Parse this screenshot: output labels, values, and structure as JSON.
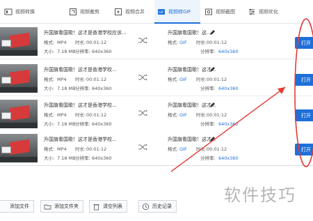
{
  "tabs": [
    {
      "id": "video-recording",
      "label": "视频转换",
      "icon": "film-icon"
    },
    {
      "id": "video-crop",
      "label": "视频裁剪",
      "icon": "crop-icon"
    },
    {
      "id": "video-merge",
      "label": "视频合并",
      "icon": "merge-icon"
    },
    {
      "id": "video-to-gif",
      "label": "视频转GIF",
      "icon": "gif-icon",
      "active": true
    },
    {
      "id": "video-screenshot",
      "label": "视频截图",
      "icon": "screenshot-icon"
    },
    {
      "id": "video-optimize",
      "label": "视频优化",
      "icon": "optimize-icon"
    }
  ],
  "rows": [
    {
      "name": "升国旗看国歌！这才是香港学校应该...",
      "src_format_label": "格式:",
      "src_format": "MP4",
      "src_duration_label": "时长:",
      "src_duration": "00:01:12",
      "src_size_label": "大小:",
      "src_size": "7.18 MB",
      "src_res_label": "分辨率:",
      "src_res": "640x360",
      "out_name": "升国旗看国歌！这...",
      "out_format_label": "格式:",
      "out_format": "GIF",
      "out_duration_label": "时长:",
      "out_duration": "00:01:12",
      "out_res_label": "分辨率:",
      "out_res": "640x360",
      "convert_label": "打开"
    },
    {
      "name": "升国旗看国歌！这才是香港学校...",
      "src_format_label": "格式:",
      "src_format": "MP4",
      "src_duration_label": "时长:",
      "src_duration": "00:01:12",
      "src_size_label": "大小:",
      "src_size": "7.18 MB",
      "src_res_label": "分辨率:",
      "src_res": "640x360",
      "out_name": "升国旗看国歌！这才...",
      "out_format_label": "格式:",
      "out_format": "GIF",
      "out_duration_label": "时长:",
      "out_duration": "00:01:12",
      "out_res_label": "分辨率:",
      "out_res": "640x360",
      "convert_label": "打开"
    },
    {
      "name": "升国旗看国歌！这才是香港学校...",
      "src_format_label": "格式:",
      "src_format": "MP4",
      "src_duration_label": "时长:",
      "src_duration": "00:01:12",
      "src_size_label": "大小:",
      "src_size": "7.18 MB",
      "src_res_label": "分辨率:",
      "src_res": "640x360",
      "out_name": "升国旗看国歌！这才...",
      "out_format_label": "格式:",
      "out_format": "GIF",
      "out_duration_label": "时长:",
      "out_duration": "00:01:12",
      "out_res_label": "分辨率:",
      "out_res": "640x360",
      "convert_label": "打开"
    },
    {
      "name": "升国旗看国歌！这才是香港学校...",
      "src_format_label": "格式:",
      "src_format": "MP4",
      "src_duration_label": "时长:",
      "src_duration": "00:01:12",
      "src_size_label": "大小:",
      "src_size": "7.18 MB",
      "src_res_label": "分辨率:",
      "src_res": "640x360",
      "out_name": "升国旗看国歌！这才...",
      "out_format_label": "格式:",
      "out_format": "GIF",
      "out_duration_label": "时长:",
      "out_duration": "00:01:12",
      "out_res_label": "分辨率:",
      "out_res": "640x360",
      "convert_label": "打开"
    }
  ],
  "bottom": {
    "add_file": "添加文件",
    "add_folder": "添加文件夹",
    "clear_list": "清空列表",
    "history": "历史记录"
  },
  "watermark": "软件技巧",
  "colors": {
    "accent": "#1e6fd9",
    "annotation": "#e53935"
  }
}
